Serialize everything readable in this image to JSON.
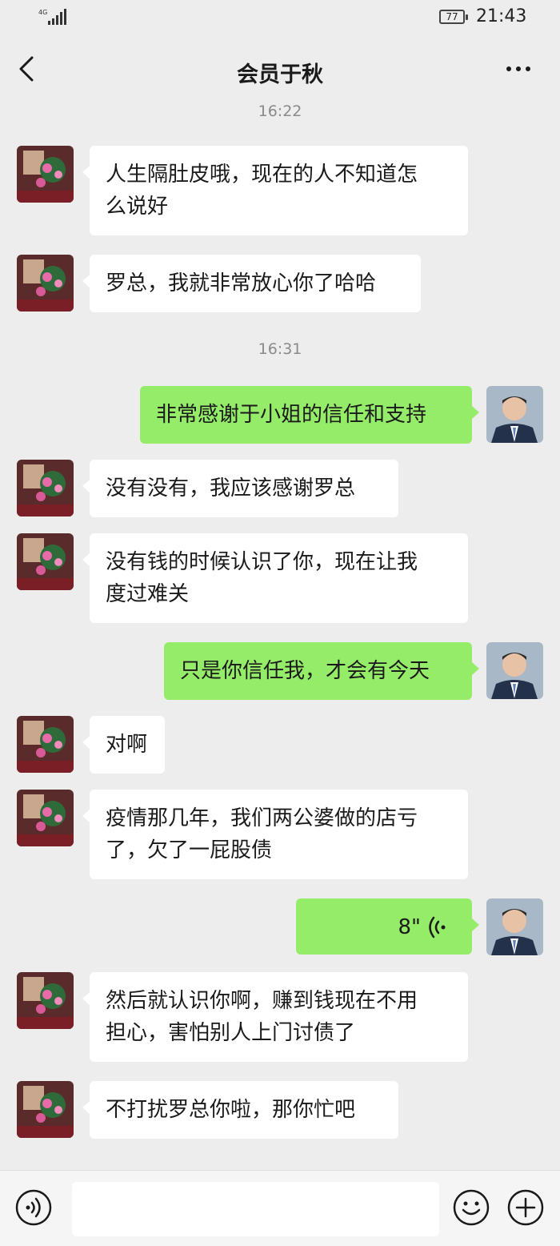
{
  "status_bar": {
    "network": "4G",
    "battery": "77",
    "time": "21:43"
  },
  "header": {
    "title": "会员于秋",
    "back_icon": "chevron-left-icon",
    "more_icon": "more-dots-icon"
  },
  "timestamps": [
    "16:22",
    "16:31"
  ],
  "messages": [
    {
      "from": "contact",
      "lines": [
        "人生隔肚皮哦，现在的人不知道怎",
        "么说好"
      ]
    },
    {
      "from": "contact",
      "lines": [
        "罗总，我就非常放心你了哈哈"
      ]
    },
    {
      "from": "me",
      "lines": [
        "非常感谢于小姐的信任和支持"
      ]
    },
    {
      "from": "contact",
      "lines": [
        "没有没有，我应该感谢罗总"
      ]
    },
    {
      "from": "contact",
      "lines": [
        "没有钱的时候认识了你，现在让我",
        "度过难关"
      ]
    },
    {
      "from": "me",
      "lines": [
        "只是你信任我，才会有今天"
      ]
    },
    {
      "from": "contact",
      "lines": [
        "对啊"
      ]
    },
    {
      "from": "contact",
      "lines": [
        "疫情那几年，我们两公婆做的店亏",
        "了，欠了一屁股债"
      ]
    },
    {
      "from": "me",
      "type": "voice",
      "duration": "8\""
    },
    {
      "from": "contact",
      "lines": [
        "然后就认识你啊，赚到钱现在不用",
        "担心，害怕别人上门讨债了"
      ]
    },
    {
      "from": "contact",
      "lines": [
        "不打扰罗总你啦，那你忙吧"
      ]
    }
  ],
  "input_bar": {
    "voice_icon": "voice-input-icon",
    "emoji_icon": "emoji-icon",
    "plus_icon": "plus-circle-icon",
    "text_value": ""
  },
  "colors": {
    "background": "#ededed",
    "outgoing_bubble": "#95ec69",
    "incoming_bubble": "#ffffff"
  }
}
